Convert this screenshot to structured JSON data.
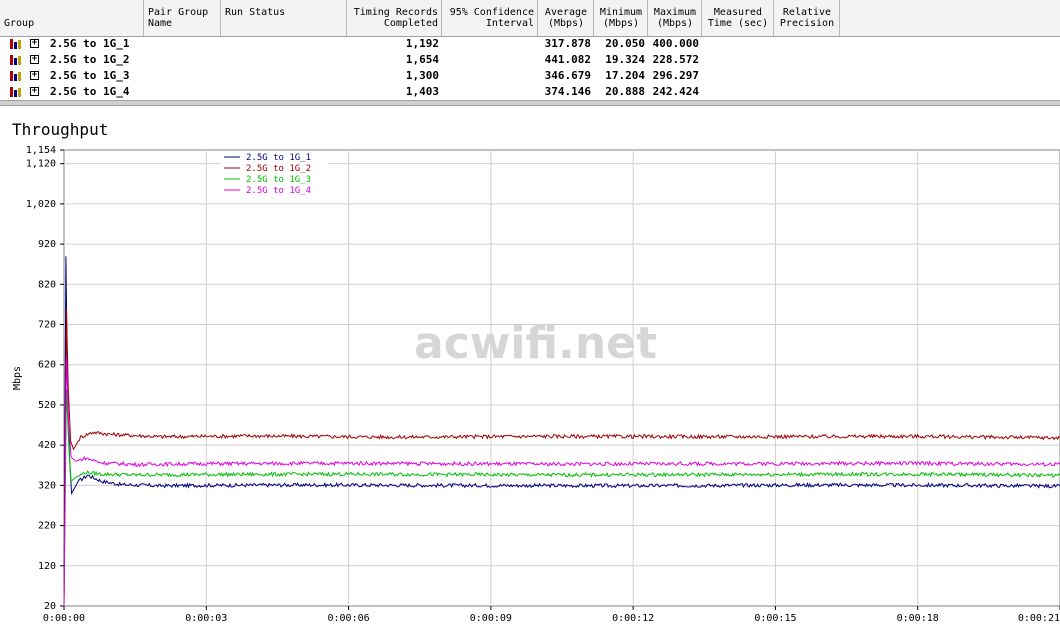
{
  "table": {
    "headers": [
      {
        "key": "group",
        "label": "Group",
        "align": "l"
      },
      {
        "key": "pair_group",
        "label": "Pair Group\nName",
        "align": "l"
      },
      {
        "key": "run_status",
        "label": "Run Status",
        "align": "l"
      },
      {
        "key": "records",
        "label": "Timing Records\nCompleted",
        "align": "r"
      },
      {
        "key": "ci",
        "label": "95% Confidence\nInterval",
        "align": "r"
      },
      {
        "key": "avg",
        "label": "Average\n(Mbps)",
        "align": "c"
      },
      {
        "key": "min",
        "label": "Minimum\n(Mbps)",
        "align": "c"
      },
      {
        "key": "max",
        "label": "Maximum\n(Mbps)",
        "align": "c"
      },
      {
        "key": "time",
        "label": "Measured\nTime (sec)",
        "align": "c"
      },
      {
        "key": "precision",
        "label": "Relative\nPrecision",
        "align": "c"
      }
    ],
    "rows": [
      {
        "group": "2.5G to 1G_1",
        "records": "1,192",
        "avg": "317.878",
        "min": "20.050",
        "max": "400.000"
      },
      {
        "group": "2.5G to 1G_2",
        "records": "1,654",
        "avg": "441.082",
        "min": "19.324",
        "max": "228.572"
      },
      {
        "group": "2.5G to 1G_3",
        "records": "1,300",
        "avg": "346.679",
        "min": "17.204",
        "max": "296.297"
      },
      {
        "group": "2.5G to 1G_4",
        "records": "1,403",
        "avg": "374.146",
        "min": "20.888",
        "max": "242.424"
      }
    ]
  },
  "chart_data": {
    "type": "line",
    "title": "Throughput",
    "ylabel": "Mbps",
    "xlabel": "",
    "ylim": [
      20,
      1154
    ],
    "xlim": [
      0,
      21
    ],
    "yticks": [
      20,
      120,
      220,
      320,
      420,
      520,
      620,
      720,
      820,
      920,
      1020,
      1120,
      1154
    ],
    "ytick_labels": [
      "20",
      "120",
      "220",
      "320",
      "420",
      "520",
      "620",
      "720",
      "820",
      "920",
      "1,020",
      "1,120",
      "1,154"
    ],
    "xticks": [
      0,
      3,
      6,
      9,
      12,
      15,
      18,
      21
    ],
    "xtick_labels": [
      "0:00:00",
      "0:00:03",
      "0:00:06",
      "0:00:09",
      "0:00:12",
      "0:00:15",
      "0:00:18",
      "0:00:21"
    ],
    "grid": true,
    "legend": "top-left",
    "series": [
      {
        "name": "2.5G to 1G_1",
        "color": "#000080",
        "steady": 320,
        "peak": 890,
        "points": [
          [
            0,
            20
          ],
          [
            0.04,
            890
          ],
          [
            0.08,
            520
          ],
          [
            0.12,
            380
          ],
          [
            0.16,
            300
          ],
          [
            0.3,
            330
          ],
          [
            0.5,
            345
          ],
          [
            0.8,
            330
          ],
          [
            1.2,
            322
          ],
          [
            2,
            319
          ],
          [
            3,
            320
          ],
          [
            5,
            321
          ],
          [
            8,
            320
          ],
          [
            12,
            319
          ],
          [
            16,
            321
          ],
          [
            19,
            320
          ],
          [
            21,
            318
          ]
        ]
      },
      {
        "name": "2.5G to 1G_2",
        "color": "#a00000",
        "steady": 441,
        "peak": 760,
        "points": [
          [
            0,
            20
          ],
          [
            0.05,
            760
          ],
          [
            0.09,
            560
          ],
          [
            0.14,
            430
          ],
          [
            0.2,
            410
          ],
          [
            0.35,
            440
          ],
          [
            0.6,
            452
          ],
          [
            1,
            447
          ],
          [
            2,
            441
          ],
          [
            4,
            443
          ],
          [
            7,
            440
          ],
          [
            10,
            442
          ],
          [
            14,
            441
          ],
          [
            18,
            442
          ],
          [
            21,
            438
          ]
        ]
      },
      {
        "name": "2.5G to 1G_3",
        "color": "#00c000",
        "steady": 347,
        "peak": 560,
        "points": [
          [
            0,
            20
          ],
          [
            0.05,
            560
          ],
          [
            0.1,
            420
          ],
          [
            0.15,
            330
          ],
          [
            0.25,
            340
          ],
          [
            0.45,
            352
          ],
          [
            0.8,
            348
          ],
          [
            1.5,
            346
          ],
          [
            3,
            347
          ],
          [
            6,
            348
          ],
          [
            10,
            346
          ],
          [
            14,
            347
          ],
          [
            18,
            348
          ],
          [
            21,
            345
          ]
        ]
      },
      {
        "name": "2.5G to 1G_4",
        "color": "#e000e0",
        "steady": 374,
        "peak": 640,
        "points": [
          [
            0,
            20
          ],
          [
            0.05,
            640
          ],
          [
            0.1,
            470
          ],
          [
            0.15,
            390
          ],
          [
            0.25,
            380
          ],
          [
            0.45,
            388
          ],
          [
            0.8,
            376
          ],
          [
            1.5,
            372
          ],
          [
            3,
            374
          ],
          [
            6,
            375
          ],
          [
            10,
            373
          ],
          [
            14,
            374
          ],
          [
            18,
            375
          ],
          [
            21,
            372
          ]
        ]
      }
    ]
  },
  "watermark": "acwifi.net"
}
